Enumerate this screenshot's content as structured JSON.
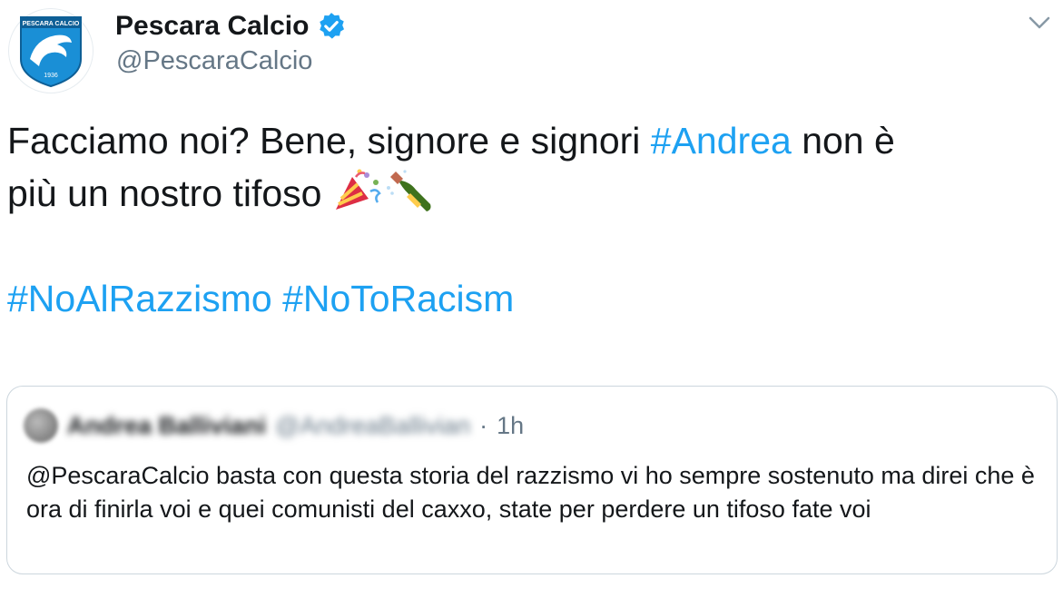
{
  "author": {
    "name": "Pescara Calcio",
    "handle": "@PescaraCalcio",
    "badge_text": "PESCARA CALCIO",
    "badge_year": "1936",
    "verified_icon": "verified-check-icon",
    "menu_icon": "chevron-down-icon"
  },
  "tweet": {
    "line1_text": "Facciamo noi? Bene, signore e signori ",
    "line1_tag": "#Andrea",
    "line1_tail": " non è",
    "line2_text": "più un nostro tifoso ",
    "emoji_1": "party-popper-icon",
    "emoji_2": "champagne-bottle-icon",
    "tag_1": "#NoAlRazzismo",
    "tag_2": "#NoToRacism"
  },
  "quoted": {
    "name": "Andrea Balliviani",
    "handle": "@AndreaBallivian",
    "separator": "·",
    "time": "1h",
    "text": "@PescaraCalcio basta con questa storia del razzismo vi ho sempre sostenuto ma direi che è ora di finirla voi e quei comunisti del caxxo, state per perdere un tifoso fate voi"
  },
  "colors": {
    "hashtag": "#1da1f2",
    "secondary": "#657786",
    "border": "#ccd6dd",
    "badge_blue": "#1a8fd6"
  }
}
